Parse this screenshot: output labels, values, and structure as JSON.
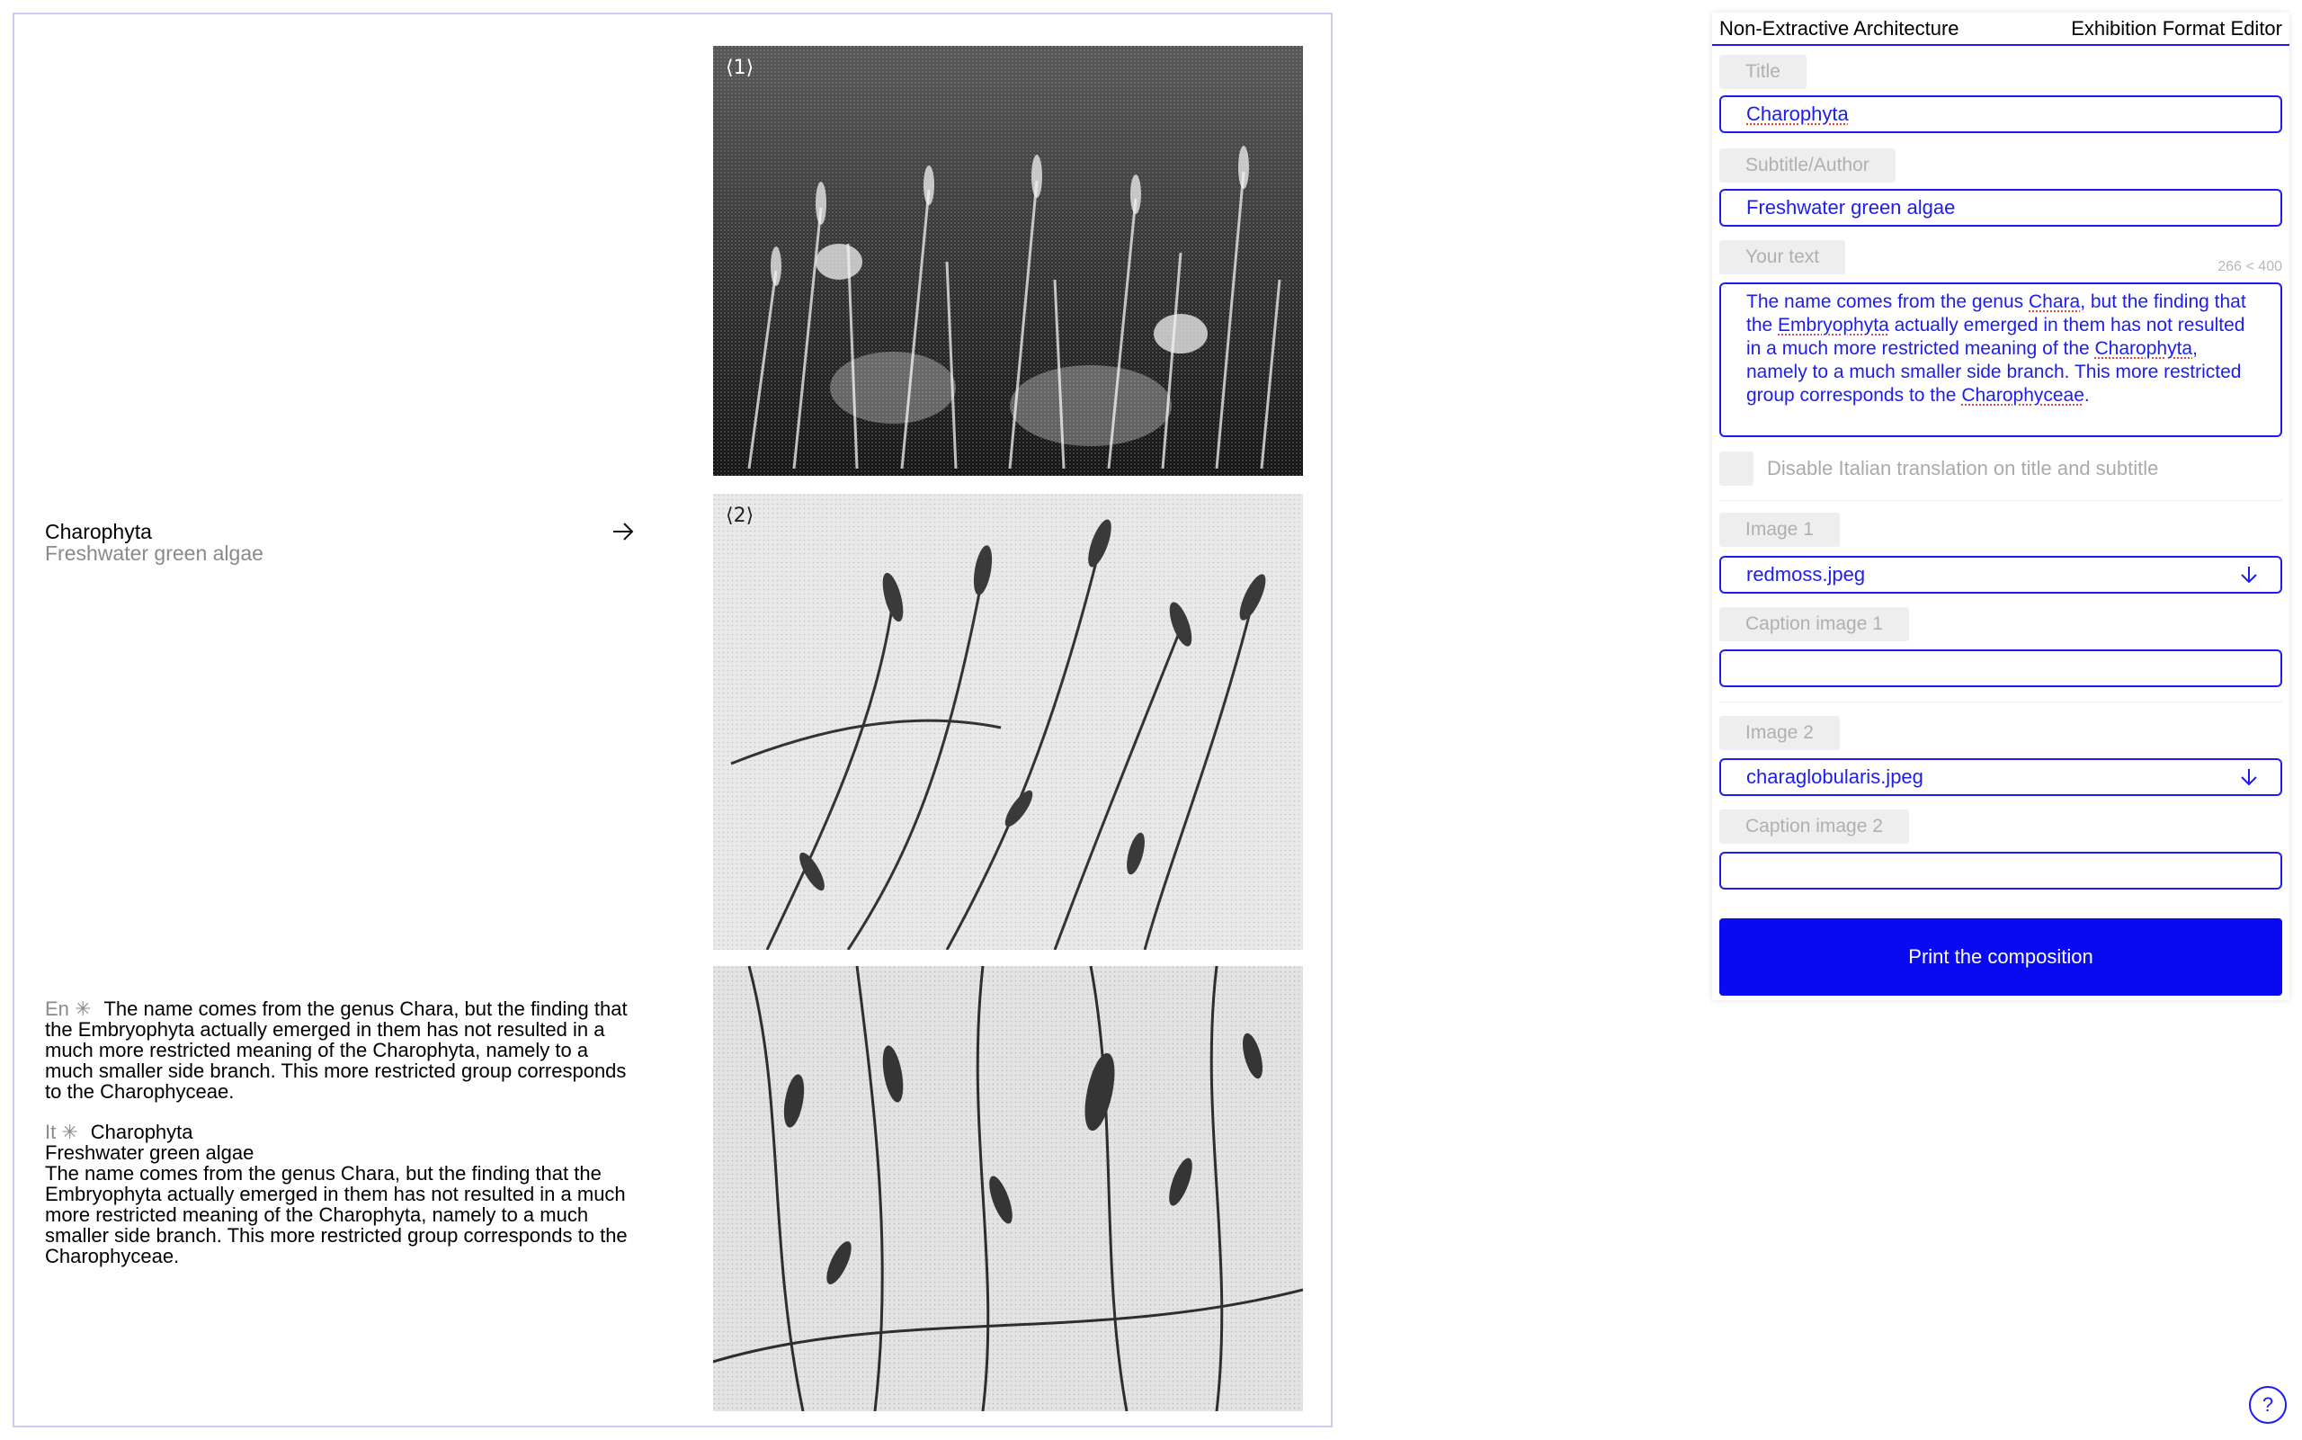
{
  "preview": {
    "title": "Charophyta",
    "subtitle": "Freshwater green algae",
    "arrow_icon": "arrow-right-icon",
    "english": {
      "lang_tag": "En ✳",
      "body": "The name comes from the genus Chara, but the finding that the Embryophyta actually emerged in them has not resulted in a much more restricted meaning of the Charophyta, namely to a much smaller side branch. This more restricted group corresponds to the Charophyceae."
    },
    "italian": {
      "lang_tag": "It ✳",
      "title": "Charophyta",
      "subtitle": "Freshwater green algae",
      "body": "The name comes from the genus Chara, but the finding that the Embryophyta actually emerged in them has not resulted in a much more restricted meaning of the Charophyta, namely to a much smaller side branch. This more restricted group corresponds to the Charophyceae."
    },
    "images": [
      {
        "number": "⟨1⟩"
      },
      {
        "number": "⟨2⟩"
      },
      {
        "number": ""
      }
    ]
  },
  "editor": {
    "header_left": "Non-Extractive Architecture",
    "header_right": "Exhibition Format Editor",
    "title_label": "Title",
    "title_value": "Charophyta",
    "subtitle_label": "Subtitle/Author",
    "subtitle_value": "Freshwater green algae",
    "text_label": "Your text",
    "text_counter": "266 < 400",
    "text_value": {
      "p1": "The name comes from the genus ",
      "w1": "Chara",
      "p2": ", but the finding that the ",
      "w2": "Embryophyta",
      "p3": " actually emerged in them has not resulted in a much more restricted meaning of the ",
      "w3": "Charophyta",
      "p4": ", namely to a much smaller side branch. This more restricted group corresponds to the ",
      "w4": "Charophyceae",
      "p5": "."
    },
    "disable_translation_label": "Disable Italian translation on title and subtitle",
    "image1_label": "Image 1",
    "image1_value": "redmoss.jpeg",
    "caption1_label": "Caption image 1",
    "caption1_value": "",
    "image2_label": "Image 2",
    "image2_value": "charaglobularis.jpeg",
    "caption2_label": "Caption image 2",
    "caption2_value": "",
    "dropdown_icon": "arrow-down-icon",
    "print_label": "Print the composition"
  },
  "help_label": "?",
  "colors": {
    "accent": "#1d1df0",
    "button": "#0a0af0",
    "label_bg": "#eeeeee",
    "muted": "#8a8a8a"
  }
}
